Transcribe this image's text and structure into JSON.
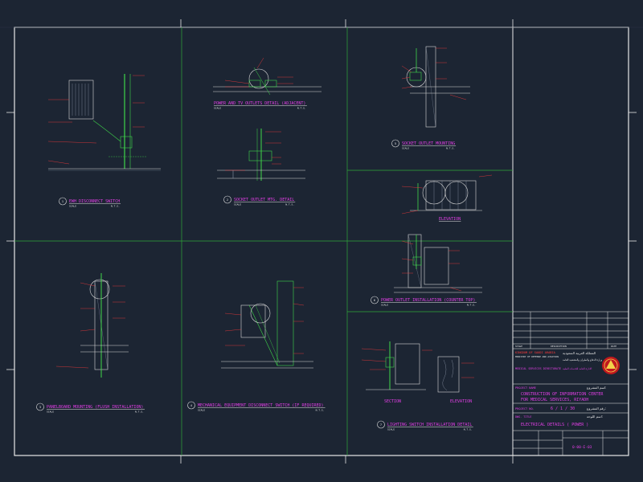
{
  "details": [
    {
      "num": "1",
      "title": "EWH DISCONNECT SWITCH",
      "scale_label": "SCALE",
      "scale_value": "N.T.S."
    },
    {
      "num": "2",
      "title": "SOCKET OUTLET MTG. DETAIL",
      "scale_label": "SCALE",
      "scale_value": "N.T.S."
    },
    {
      "num": "",
      "title": "POWER AND TV OUTLETS DETAIL (ADJACENT)",
      "scale_label": "SCALE",
      "scale_value": "N.T.S."
    },
    {
      "num": "5",
      "title": "SOCKET OUTLET MOUNTING",
      "scale_label": "SCALE",
      "scale_value": "N.T.S."
    },
    {
      "num": "",
      "title": "ELEVATION",
      "scale_label": "",
      "scale_value": ""
    },
    {
      "num": "6",
      "title": "POWER OUTLET INSTALLATION (COUNTER TOP)",
      "scale_label": "SCALE",
      "scale_value": "N.T.S."
    },
    {
      "num": "3",
      "title": "PANELBOARD MOUNTING (FLUSH INSTALLATION)",
      "scale_label": "SCALE",
      "scale_value": "N.T.S."
    },
    {
      "num": "4",
      "title": "MECHANICAL EQUIPMENT DISCONNECT SWITCH (IF REQUIRED)",
      "scale_label": "SCALE",
      "scale_value": "N.T.S."
    },
    {
      "num": "7",
      "title": "LIGHTING SWITCH INSTALLATION DETAIL",
      "scale_label": "SCALE",
      "scale_value": "N.T.S."
    }
  ],
  "sub_labels": {
    "section": "SECTION",
    "elevation": "ELEVATION"
  },
  "title_block": {
    "rev_header": [
      "STAGE",
      "DESCRIPTION",
      "",
      "DATE"
    ],
    "org_en": [
      "KINGDOM OF SAUDI ARABIA",
      "MINISTRY OF DEFENSE AND AVIATION"
    ],
    "org_en_sub": "MEDICAL SERVICES DIRECTORATE",
    "org_ar": [
      "المملكة العربية السعودية",
      "وزارة الدفاع والطيران والمفتشية العامة",
      "الادارة العامة للخدمات الطبية"
    ],
    "project_name_label": "PROJECT NAME",
    "project_name_ar": "اسم المشروع:",
    "project_name": [
      "CONSTRUCTION OF INFORMATION CENTER",
      "FOR MEDICAL SERVICES, RIYADH"
    ],
    "project_no_label": "PROJECT NO.",
    "project_no": "6 / 1 / 30",
    "project_no_ar": "رقم المشروع:",
    "dwg_title_label": "DWG. TITLE",
    "dwg_title_ar": "اسم اللوحة:",
    "dwg_title": "ELECTRICAL DETAILS ( POWER )",
    "dwg_no": "0-00-E-03"
  },
  "colors": {
    "bg": "#1c2533",
    "frame": "#e8e8e8",
    "grid": "#2fa83a",
    "title": "#e23fe6",
    "red": "#ff3a3a",
    "green": "#3fd64a"
  }
}
